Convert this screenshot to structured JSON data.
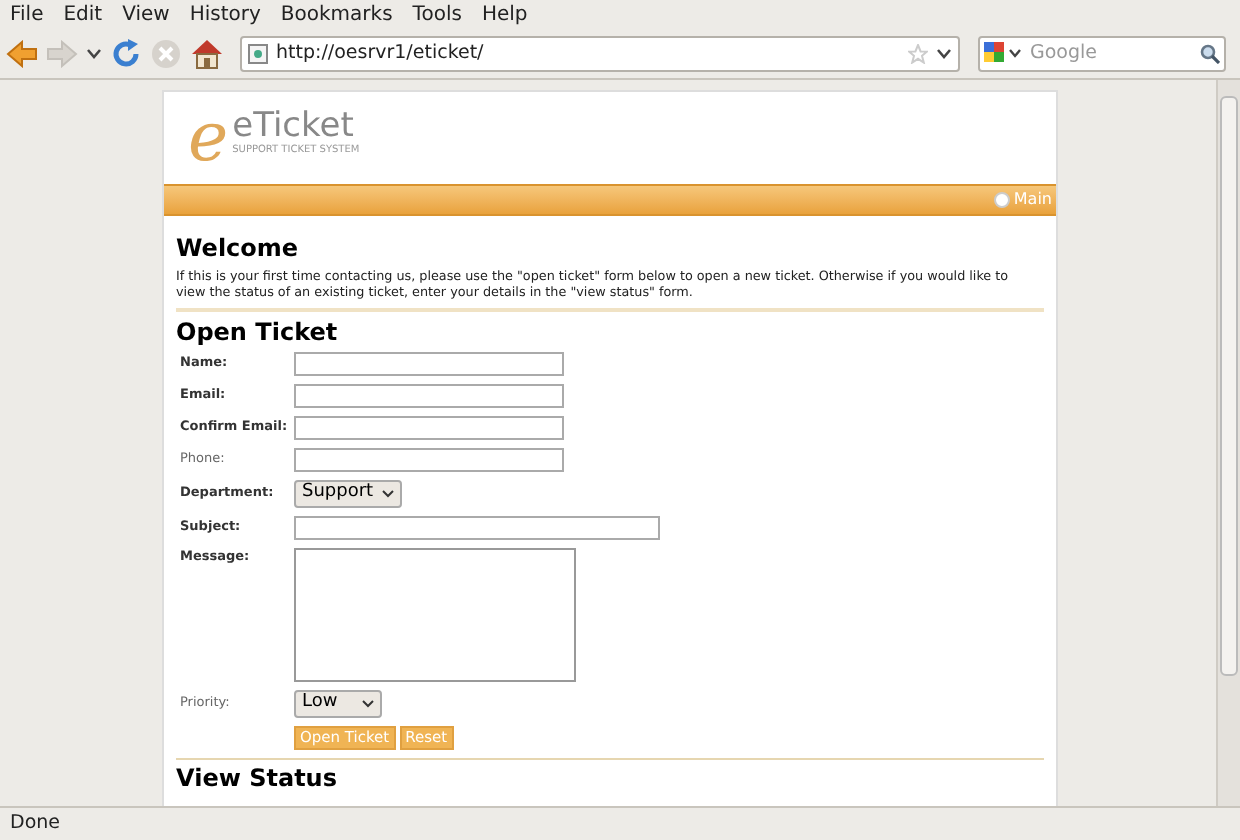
{
  "menu": [
    "File",
    "Edit",
    "View",
    "History",
    "Bookmarks",
    "Tools",
    "Help"
  ],
  "toolbar": {
    "url": "http://oesrvr1/eticket/",
    "search_placeholder": "Google"
  },
  "page": {
    "logo": {
      "letter": "e",
      "name": "eTicket",
      "tagline": "SUPPORT TICKET SYSTEM"
    },
    "nav": [
      "Main"
    ],
    "welcome": {
      "title": "Welcome",
      "text": "If this is your first time contacting us, please use the \"open ticket\" form below to open a new ticket. Otherwise if you would like to view the status of an existing ticket, enter your details in the \"view status\" form."
    },
    "form": {
      "title": "Open Ticket",
      "fields": [
        {
          "kind": "text",
          "label": "Name:",
          "required": true
        },
        {
          "kind": "text",
          "label": "Email:",
          "required": true
        },
        {
          "kind": "text",
          "label": "Confirm Email:",
          "required": true
        },
        {
          "kind": "text",
          "label": "Phone:",
          "required": false
        },
        {
          "kind": "select",
          "label": "Department:",
          "required": true,
          "value": "Support"
        },
        {
          "kind": "wide",
          "label": "Subject:",
          "required": true
        },
        {
          "kind": "textarea",
          "label": "Message:",
          "required": true
        },
        {
          "kind": "select",
          "label": "Priority:",
          "required": false,
          "value": "Low"
        }
      ],
      "buttons": [
        "Open Ticket",
        "Reset"
      ]
    },
    "next_section": "View Status"
  },
  "status_bar": "Done"
}
